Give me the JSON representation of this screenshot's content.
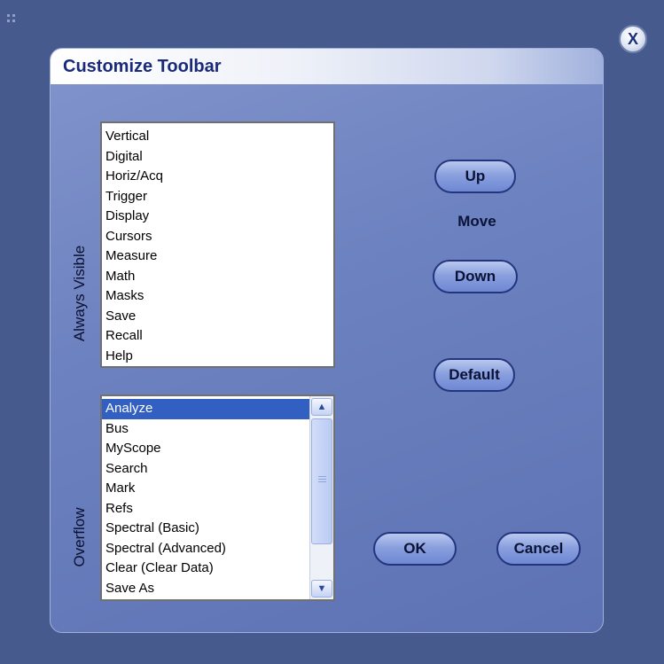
{
  "dialog": {
    "title": "Customize Toolbar",
    "close_label": "X"
  },
  "always_visible": {
    "label": "Always Visible",
    "items": [
      "Vertical",
      "Digital",
      "Horiz/Acq",
      "Trigger",
      "Display",
      "Cursors",
      "Measure",
      "Math",
      "Masks",
      "Save",
      "Recall",
      "Help"
    ]
  },
  "overflow": {
    "label": "Overflow",
    "selected": "Analyze",
    "items": [
      "Analyze",
      "Bus",
      "MyScope",
      "Search",
      "Mark",
      "Refs",
      "Spectral (Basic)",
      "Spectral (Advanced)",
      "Clear (Clear Data)",
      "Save As"
    ]
  },
  "buttons": {
    "up": "Up",
    "move": "Move",
    "down": "Down",
    "default": "Default",
    "ok": "OK",
    "cancel": "Cancel"
  },
  "icons": {
    "close": "close-icon",
    "scroll_up": "arrow-up-icon",
    "scroll_down": "arrow-down-icon",
    "grip": "resize-grip-icon"
  },
  "colors": {
    "background": "#465a8e",
    "panel": "#6d82c0",
    "title_text": "#1a2a7a",
    "selection": "#3160c2"
  }
}
